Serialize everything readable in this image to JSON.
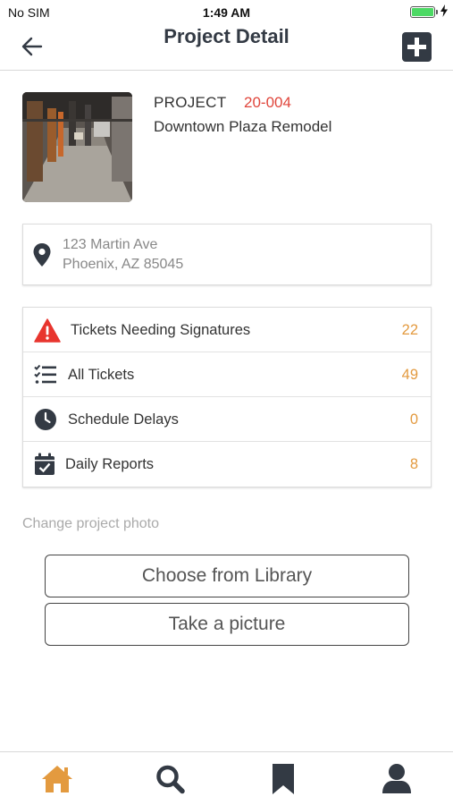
{
  "status_bar": {
    "carrier": "No SIM",
    "time": "1:49 AM",
    "battery_level": 1.0
  },
  "nav": {
    "title": "Project Detail",
    "back_icon": "arrow-left-icon",
    "add_icon": "plus-square-icon"
  },
  "project": {
    "label": "PROJECT",
    "number": "20-004",
    "name": "Downtown Plaza Remodel"
  },
  "address": {
    "line1": "123 Martin Ave",
    "line2": "Phoenix, AZ 85045",
    "icon": "map-pin-icon"
  },
  "menu": [
    {
      "label": "Tickets Needing Signatures",
      "count": "22",
      "icon": "warning-icon"
    },
    {
      "label": "All Tickets",
      "count": "49",
      "icon": "checklist-icon"
    },
    {
      "label": "Schedule Delays",
      "count": "0",
      "icon": "clock-icon"
    },
    {
      "label": "Daily Reports",
      "count": "8",
      "icon": "calendar-check-icon"
    }
  ],
  "photo_section": {
    "label": "Change project photo",
    "choose_library": "Choose from Library",
    "take_picture": "Take a picture"
  },
  "tabs": [
    {
      "name": "home",
      "icon": "home-icon",
      "active": true
    },
    {
      "name": "search",
      "icon": "search-icon",
      "active": false
    },
    {
      "name": "bookmarks",
      "icon": "bookmark-icon",
      "active": false
    },
    {
      "name": "profile",
      "icon": "user-icon",
      "active": false
    }
  ],
  "colors": {
    "accent_orange": "#e39a3f",
    "project_number_red": "#e0463c",
    "nav_dark": "#333a44",
    "warning_red": "#e8352e"
  }
}
